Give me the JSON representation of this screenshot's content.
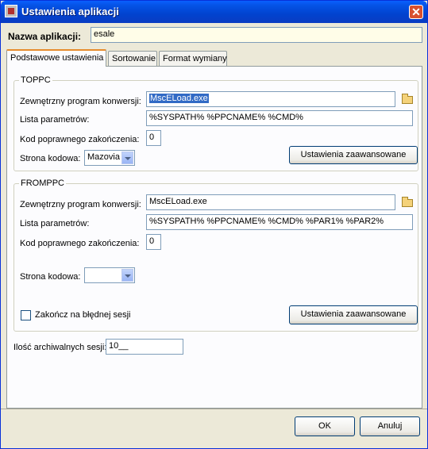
{
  "window": {
    "title": "Ustawienia aplikacji",
    "close_symbol": "✕"
  },
  "app_name": {
    "label": "Nazwa aplikacji:",
    "value": "esale"
  },
  "tabs": [
    {
      "label": "Podstawowe ustawienia",
      "active": true
    },
    {
      "label": "Sortowanie",
      "active": false
    },
    {
      "label": "Format wymiany",
      "active": false
    }
  ],
  "toppc": {
    "title": "TOPPC",
    "converter_label": "Zewnętrzny program konwersji:",
    "converter_value": "MscELoad.exe",
    "params_label": "Lista parametrów:",
    "params_value": "%SYSPATH% %PPCNAME% %CMD%",
    "exitcode_label": "Kod poprawnego zakończenia:",
    "exitcode_value": "0",
    "codepage_label": "Strona kodowa:",
    "codepage_value": "Mazovia",
    "advanced_button": "Ustawienia zaawansowane"
  },
  "fromppc": {
    "title": "FROMPPC",
    "converter_label": "Zewnętrzny program konwersji:",
    "converter_value": "MscELoad.exe",
    "params_label": "Lista parametrów:",
    "params_value": "%SYSPATH% %PPCNAME% %CMD% %PAR1% %PAR2%",
    "exitcode_label": "Kod poprawnego zakończenia:",
    "exitcode_value": "0",
    "codepage_label": "Strona kodowa:",
    "codepage_value": "",
    "checkbox_label": "Zakończ na błędnej sesji",
    "checkbox_checked": false,
    "advanced_button": "Ustawienia zaawansowane"
  },
  "archive": {
    "label": "Ilość archiwalnych sesji:",
    "value": "10__"
  },
  "footer": {
    "ok": "OK",
    "cancel": "Anuluj"
  },
  "icons": {
    "app": "app-icon",
    "browse": "folder-open-icon",
    "dropdown": "chevron-down-icon"
  }
}
